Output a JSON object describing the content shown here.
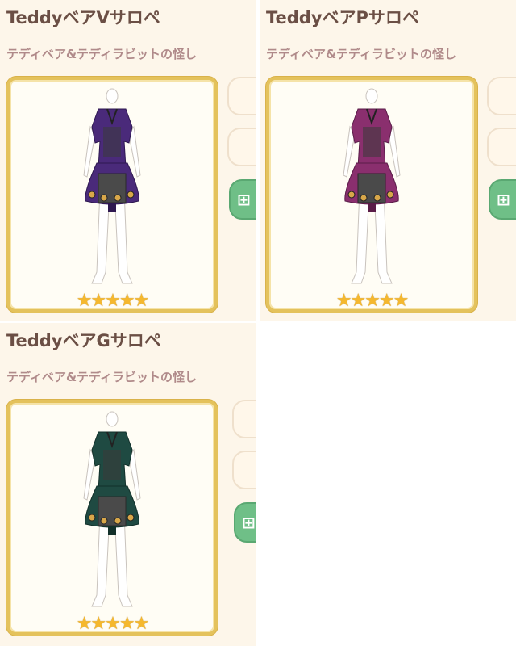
{
  "items": [
    {
      "name": "TeddyベアVサロペ",
      "series": "テディベア&テディラビットの怪し",
      "rarity": "★★★★★",
      "color": "#4a2a7a",
      "color_dark": "#2e1850",
      "gift_icon": "gift-icon"
    },
    {
      "name": "TeddyベアPサロペ",
      "series": "テディベア&テディラビットの怪し",
      "rarity": "★★★★★",
      "color": "#8a2f6e",
      "color_dark": "#5a1c48",
      "gift_icon": "gift-icon"
    },
    {
      "name": "TeddyベアGサロペ",
      "series": "テディベア&テディラビットの怪し",
      "rarity": "★★★★★",
      "color": "#1f4a42",
      "color_dark": "#12302a",
      "gift_icon": "gift-icon"
    }
  ]
}
